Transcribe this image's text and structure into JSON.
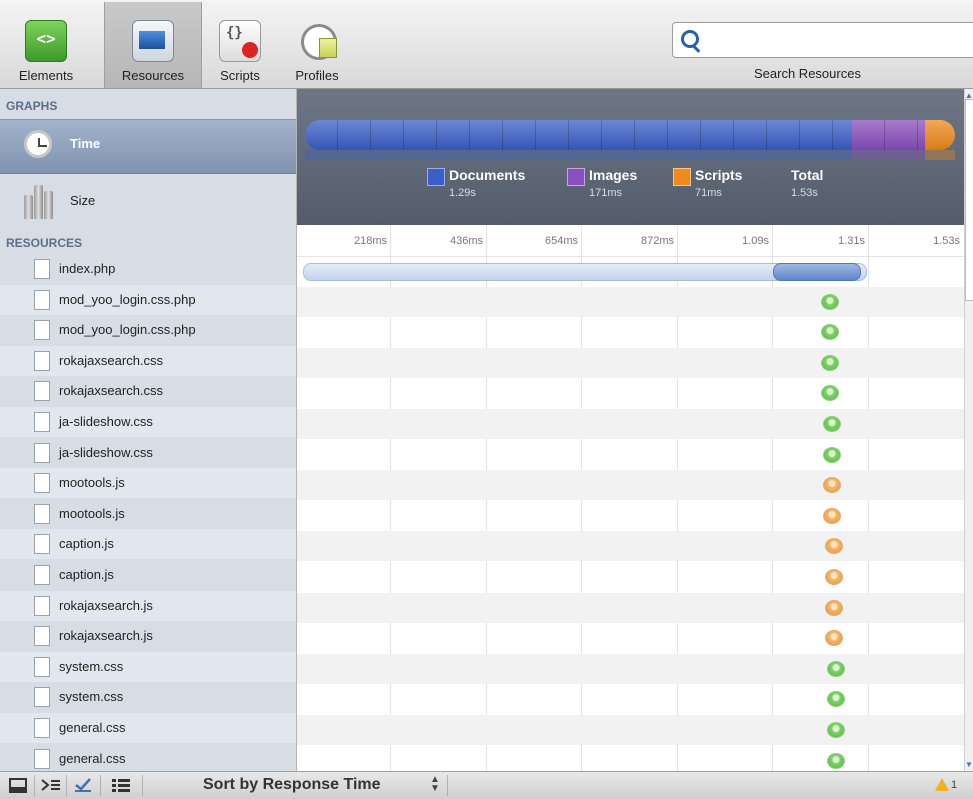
{
  "toolbar": {
    "buttons": [
      {
        "label": "Elements",
        "icon": "elements-icon"
      },
      {
        "label": "Resources",
        "icon": "resources-icon",
        "selected": true
      },
      {
        "label": "Scripts",
        "icon": "scripts-icon"
      },
      {
        "label": "Profiles",
        "icon": "profiles-icon"
      }
    ],
    "search": {
      "placeholder": "",
      "label": "Search Resources"
    }
  },
  "sidebar": {
    "graphs_header": "GRAPHS",
    "graphs": [
      {
        "label": "Time",
        "icon": "clock-icon",
        "selected": true
      },
      {
        "label": "Size",
        "icon": "size-icon"
      }
    ],
    "resources_header": "RESOURCES",
    "resources": [
      {
        "name": "index.php",
        "type": "document"
      },
      {
        "name": "mod_yoo_login.css.php",
        "type": "stylesheet"
      },
      {
        "name": "mod_yoo_login.css.php",
        "type": "stylesheet"
      },
      {
        "name": "rokajaxsearch.css",
        "type": "stylesheet"
      },
      {
        "name": "rokajaxsearch.css",
        "type": "stylesheet"
      },
      {
        "name": "ja-slideshow.css",
        "type": "stylesheet"
      },
      {
        "name": "ja-slideshow.css",
        "type": "stylesheet"
      },
      {
        "name": "mootools.js",
        "type": "script"
      },
      {
        "name": "mootools.js",
        "type": "script"
      },
      {
        "name": "caption.js",
        "type": "script"
      },
      {
        "name": "caption.js",
        "type": "script"
      },
      {
        "name": "rokajaxsearch.js",
        "type": "script"
      },
      {
        "name": "rokajaxsearch.js",
        "type": "script"
      },
      {
        "name": "system.css",
        "type": "stylesheet"
      },
      {
        "name": "system.css",
        "type": "stylesheet"
      },
      {
        "name": "general.css",
        "type": "stylesheet"
      },
      {
        "name": "general.css",
        "type": "stylesheet"
      }
    ]
  },
  "summary": {
    "categories": [
      {
        "name": "Documents",
        "value": "1.29s",
        "seconds": 1.29,
        "color": "#3a5fc8"
      },
      {
        "name": "Images",
        "value": "171ms",
        "seconds": 0.171,
        "color": "#8a4fc0"
      },
      {
        "name": "Scripts",
        "value": "71ms",
        "seconds": 0.071,
        "color": "#f08a1c"
      }
    ],
    "total": {
      "name": "Total",
      "value": "1.53s",
      "seconds": 1.53
    }
  },
  "timeline": {
    "ticks": [
      "218ms",
      "436ms",
      "654ms",
      "872ms",
      "1.09s",
      "1.31s",
      "1.53s"
    ],
    "document_bar": {
      "start_s": 0.0,
      "latency_end_s": 1.09,
      "end_s": 1.3
    },
    "dots": [
      {
        "type": "css",
        "at_s": 1.22
      },
      {
        "type": "css",
        "at_s": 1.22
      },
      {
        "type": "css",
        "at_s": 1.22
      },
      {
        "type": "css",
        "at_s": 1.22
      },
      {
        "type": "css",
        "at_s": 1.225
      },
      {
        "type": "css",
        "at_s": 1.225
      },
      {
        "type": "js",
        "at_s": 1.225
      },
      {
        "type": "js",
        "at_s": 1.225
      },
      {
        "type": "js",
        "at_s": 1.23
      },
      {
        "type": "js",
        "at_s": 1.23
      },
      {
        "type": "js",
        "at_s": 1.23
      },
      {
        "type": "js",
        "at_s": 1.23
      },
      {
        "type": "css",
        "at_s": 1.235
      },
      {
        "type": "css",
        "at_s": 1.235
      },
      {
        "type": "css",
        "at_s": 1.235
      },
      {
        "type": "css",
        "at_s": 1.235
      }
    ]
  },
  "statusbar": {
    "sort_label": "Sort by Response Time",
    "warning_count": "1"
  },
  "colors": {
    "accent": "#8093ae",
    "row_alt": "#e1e7ef"
  }
}
